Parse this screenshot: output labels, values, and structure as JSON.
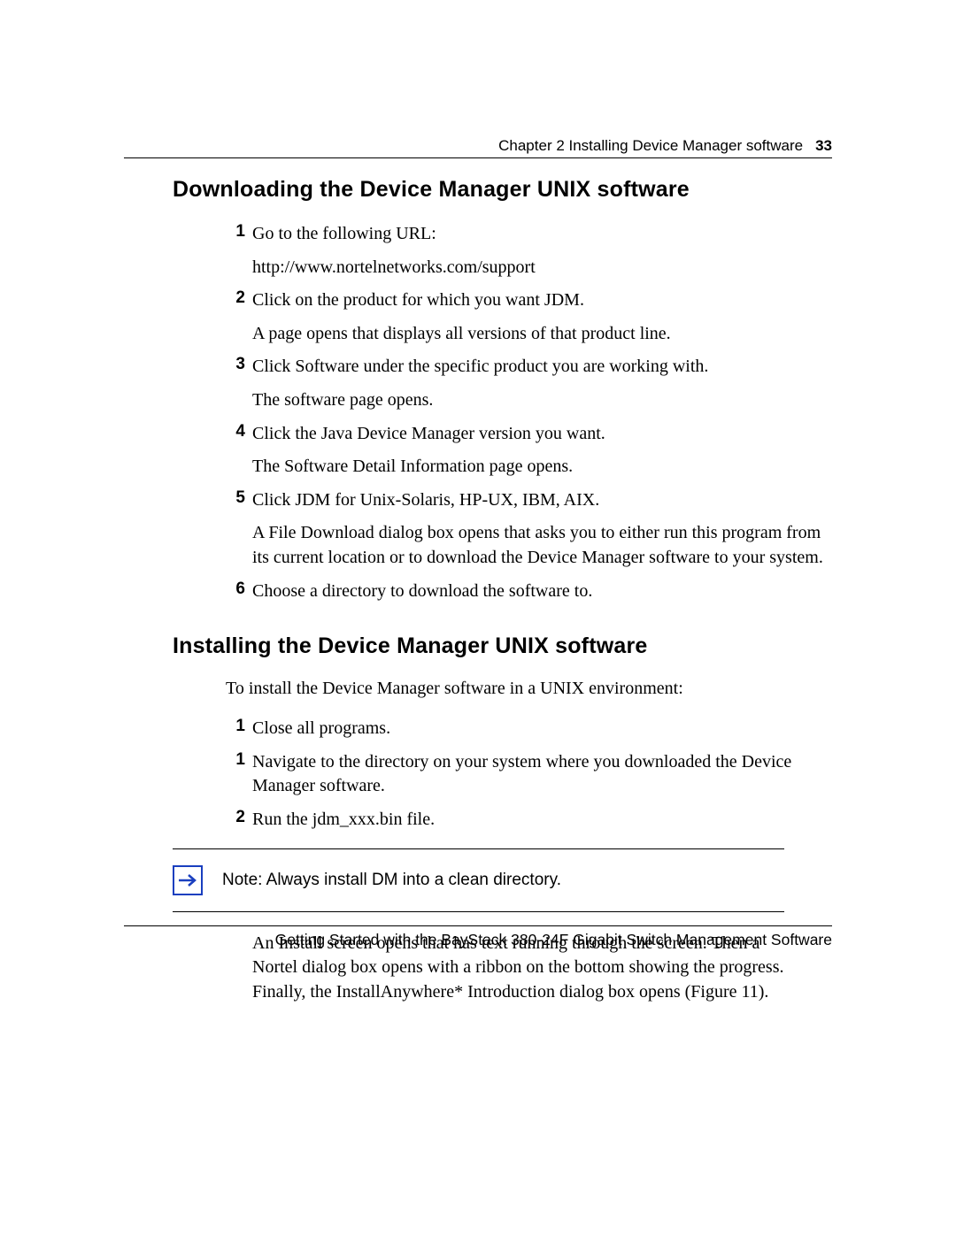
{
  "header": {
    "chapter_label": "Chapter 2  Installing Device Manager software",
    "page_number": "33"
  },
  "section1": {
    "title": "Downloading the Device Manager UNIX software",
    "steps": [
      {
        "n": "1",
        "text": "Go to the following URL:",
        "sub": "http://www.nortelnetworks.com/support"
      },
      {
        "n": "2",
        "text": "Click on the product for which you want JDM.",
        "sub": "A page opens that displays all versions of that product line."
      },
      {
        "n": "3",
        "text": "Click Software under the specific product you are working with.",
        "sub": "The software page opens."
      },
      {
        "n": "4",
        "text": "Click the Java Device Manager version you want.",
        "sub": "The Software Detail Information page opens."
      },
      {
        "n": "5",
        "text": "Click JDM for Unix-Solaris, HP-UX, IBM, AIX.",
        "sub": "A File Download dialog box opens that asks you to either run this program from its current location or to download the Device Manager software to your system."
      },
      {
        "n": "6",
        "text": "Choose a directory to download the software to."
      }
    ]
  },
  "section2": {
    "title": "Installing the Device Manager UNIX software",
    "intro": "To install the Device Manager software in a UNIX environment:",
    "steps": [
      {
        "n": "1",
        "text": "Close all programs."
      },
      {
        "n": "1",
        "text": "Navigate to the directory on your system where you downloaded the Device Manager software."
      },
      {
        "n": "2",
        "text": "Run the jdm_xxx.bin file."
      }
    ],
    "note": "Note: Always install DM into a clean directory.",
    "after_note": "An Install screen opens that has text running through the screen. Then a Nortel dialog box opens with a ribbon on the bottom showing the progress. Finally, the InstallAnywhere* Introduction dialog box opens (Figure 11)."
  },
  "footer": {
    "text": "Getting Started with the BayStack 380-24F Gigabit Switch Management Software"
  },
  "icons": {
    "note_arrow": "arrow-right-icon"
  }
}
